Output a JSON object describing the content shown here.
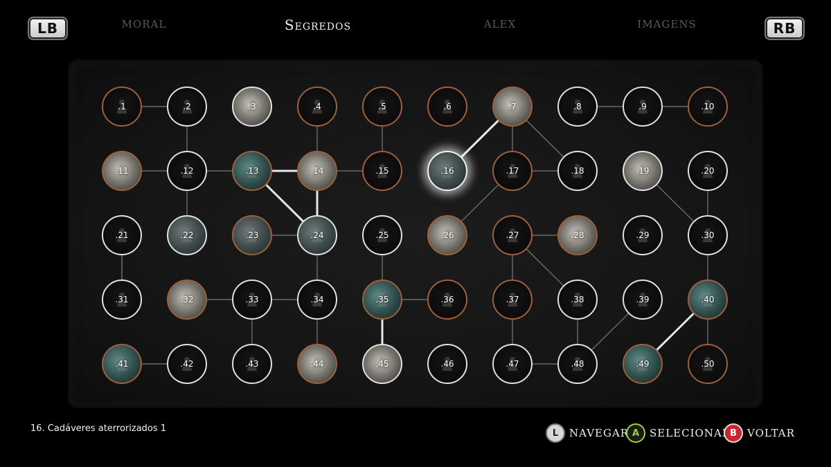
{
  "nav": {
    "lb_label": "LB",
    "rb_label": "RB",
    "tabs": [
      {
        "label": "Moral",
        "active": false
      },
      {
        "label": "Segredos",
        "active": true
      },
      {
        "label": "Alex",
        "active": false
      },
      {
        "label": "Imagens",
        "active": false
      }
    ]
  },
  "nodes": [
    {
      "label": ".1",
      "border": "orange",
      "img": "none"
    },
    {
      "label": ".2",
      "border": "white",
      "img": "none"
    },
    {
      "label": ".3",
      "border": "white",
      "img": "paper"
    },
    {
      "label": ".4",
      "border": "orange",
      "img": "none"
    },
    {
      "label": ".5",
      "border": "orange",
      "img": "none"
    },
    {
      "label": ".6",
      "border": "orange",
      "img": "none"
    },
    {
      "label": ".7",
      "border": "orange",
      "img": "paper"
    },
    {
      "label": ".8",
      "border": "white",
      "img": "none"
    },
    {
      "label": ".9",
      "border": "white",
      "img": "none"
    },
    {
      "label": ".10",
      "border": "orange",
      "img": "none"
    },
    {
      "label": ".11",
      "border": "orange",
      "img": "paper"
    },
    {
      "label": ".12",
      "border": "white",
      "img": "none"
    },
    {
      "label": ".13",
      "border": "orange",
      "img": "teal"
    },
    {
      "label": ".14",
      "border": "orange",
      "img": "paper"
    },
    {
      "label": ".15",
      "border": "orange",
      "img": "none"
    },
    {
      "label": ".16",
      "border": "selected",
      "img": "dark"
    },
    {
      "label": ".17",
      "border": "orange",
      "img": "none"
    },
    {
      "label": ".18",
      "border": "white",
      "img": "none"
    },
    {
      "label": ".19",
      "border": "white",
      "img": "paper"
    },
    {
      "label": ".20",
      "border": "white",
      "img": "none"
    },
    {
      "label": ".21",
      "border": "white",
      "img": "none"
    },
    {
      "label": ".22",
      "border": "white",
      "img": "dark"
    },
    {
      "label": ".23",
      "border": "orange",
      "img": "dark"
    },
    {
      "label": ".24",
      "border": "white",
      "img": "dark"
    },
    {
      "label": ".25",
      "border": "white",
      "img": "none"
    },
    {
      "label": ".26",
      "border": "orange",
      "img": "paper"
    },
    {
      "label": ".27",
      "border": "orange",
      "img": "none"
    },
    {
      "label": ".28",
      "border": "orange",
      "img": "paper"
    },
    {
      "label": ".29",
      "border": "white",
      "img": "none"
    },
    {
      "label": ".30",
      "border": "white",
      "img": "none"
    },
    {
      "label": ".31",
      "border": "white",
      "img": "none"
    },
    {
      "label": ".32",
      "border": "orange",
      "img": "paper"
    },
    {
      "label": ".33",
      "border": "white",
      "img": "none"
    },
    {
      "label": ".34",
      "border": "white",
      "img": "none"
    },
    {
      "label": ".35",
      "border": "orange",
      "img": "teal"
    },
    {
      "label": ".36",
      "border": "orange",
      "img": "none"
    },
    {
      "label": ".37",
      "border": "orange",
      "img": "none"
    },
    {
      "label": ".38",
      "border": "white",
      "img": "none"
    },
    {
      "label": ".39",
      "border": "white",
      "img": "none"
    },
    {
      "label": ".40",
      "border": "orange",
      "img": "teal"
    },
    {
      "label": ".41",
      "border": "orange",
      "img": "teal"
    },
    {
      "label": ".42",
      "border": "white",
      "img": "none"
    },
    {
      "label": ".43",
      "border": "white",
      "img": "none"
    },
    {
      "label": ".44",
      "border": "orange",
      "img": "paper"
    },
    {
      "label": ".45",
      "border": "white",
      "img": "paper"
    },
    {
      "label": ".46",
      "border": "white",
      "img": "none"
    },
    {
      "label": ".47",
      "border": "white",
      "img": "none"
    },
    {
      "label": ".48",
      "border": "white",
      "img": "none"
    },
    {
      "label": ".49",
      "border": "orange",
      "img": "teal"
    },
    {
      "label": ".50",
      "border": "orange",
      "img": "none"
    }
  ],
  "links": [
    [
      1,
      2
    ],
    [
      9,
      10
    ],
    [
      8,
      9
    ],
    [
      2,
      12
    ],
    [
      4,
      14
    ],
    [
      5,
      15
    ],
    [
      11,
      12
    ],
    [
      12,
      13
    ],
    [
      14,
      15
    ],
    [
      17,
      18
    ],
    [
      7,
      17
    ],
    [
      7,
      18
    ],
    [
      12,
      22
    ],
    [
      14,
      24
    ],
    [
      21,
      31
    ],
    [
      24,
      34
    ],
    [
      25,
      35
    ],
    [
      27,
      28
    ],
    [
      27,
      37
    ],
    [
      26,
      17
    ],
    [
      33,
      34
    ],
    [
      32,
      33
    ],
    [
      31,
      21
    ],
    [
      33,
      43
    ],
    [
      34,
      44
    ],
    [
      35,
      36
    ],
    [
      38,
      48
    ],
    [
      41,
      42
    ],
    [
      47,
      48
    ],
    [
      48,
      39
    ],
    [
      37,
      47
    ],
    [
      27,
      38
    ],
    [
      20,
      30
    ],
    [
      19,
      30
    ],
    [
      30,
      40
    ],
    [
      40,
      50
    ],
    [
      23,
      24
    ]
  ],
  "highlight_links": [
    [
      7,
      16
    ],
    [
      13,
      14
    ],
    [
      13,
      24
    ],
    [
      14,
      24
    ],
    [
      35,
      45
    ],
    [
      40,
      49
    ]
  ],
  "caption": "16. Cadáveres aterrorizados 1",
  "hints": [
    {
      "key": "L",
      "label": "Navegar"
    },
    {
      "key": "A",
      "label": "Selecionar"
    },
    {
      "key": "B",
      "label": "Voltar"
    }
  ]
}
